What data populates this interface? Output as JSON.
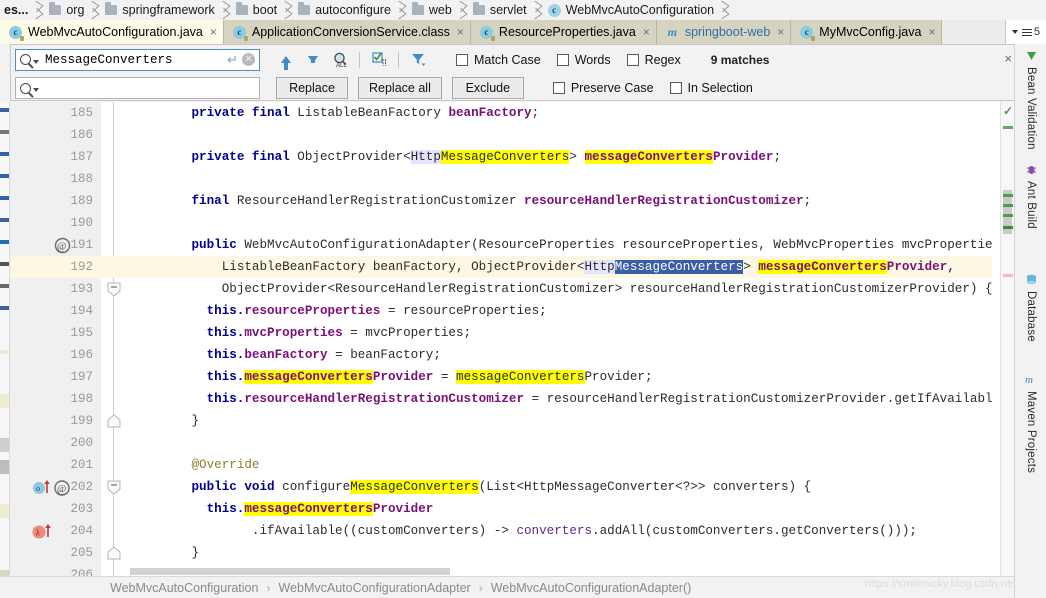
{
  "breadcrumb": {
    "items": [
      {
        "label": "es...",
        "icon": "folder-icon"
      },
      {
        "label": "org",
        "icon": "folder-icon"
      },
      {
        "label": "springframework",
        "icon": "folder-icon"
      },
      {
        "label": "boot",
        "icon": "folder-icon"
      },
      {
        "label": "autoconfigure",
        "icon": "folder-icon"
      },
      {
        "label": "web",
        "icon": "folder-icon"
      },
      {
        "label": "servlet",
        "icon": "folder-icon"
      },
      {
        "label": "WebMvcAutoConfiguration",
        "icon": "class-icon"
      }
    ]
  },
  "tabs": {
    "items": [
      {
        "label": "WebMvcAutoConfiguration.java",
        "icon": "class-icon",
        "active": true,
        "close": "×"
      },
      {
        "label": "ApplicationConversionService.class",
        "icon": "class-icon",
        "active": false,
        "close": "×"
      },
      {
        "label": "ResourceProperties.java",
        "icon": "class-icon",
        "active": false,
        "close": "×"
      },
      {
        "label": "springboot-web",
        "icon": "module-icon",
        "active": false,
        "close": "×"
      },
      {
        "label": "MyMvcConfig.java",
        "icon": "class-icon",
        "active": false,
        "close": "×"
      }
    ],
    "overflow_count": "5"
  },
  "find": {
    "search_value": "MessageConverters",
    "search_placeholder": "",
    "replace_value": "",
    "replace_placeholder": "",
    "buttons": {
      "replace": "Replace",
      "replace_all": "Replace all",
      "exclude": "Exclude"
    },
    "options": [
      {
        "label": "Match Case",
        "checked": false
      },
      {
        "label": "Words",
        "checked": false
      },
      {
        "label": "Regex",
        "checked": false
      },
      {
        "label": "Preserve Case",
        "checked": false
      },
      {
        "label": "In Selection",
        "checked": false
      }
    ],
    "matches_text": "9 matches",
    "close_label": "×",
    "tool_icons": [
      "find-previous-icon",
      "find-next-icon",
      "find-all-icon",
      "select-all-occurrences-icon",
      "filter-icon"
    ]
  },
  "editor": {
    "current_line": 192,
    "lines": [
      {
        "n": 185,
        "indent": 8,
        "tokens": [
          {
            "t": "private final ",
            "c": "kw"
          },
          {
            "t": "ListableBeanFactory ",
            "c": "plain"
          },
          {
            "t": "beanFactory",
            "c": "fld"
          },
          {
            "t": ";",
            "c": "plain"
          }
        ]
      },
      {
        "n": 186,
        "indent": 0,
        "tokens": []
      },
      {
        "n": 187,
        "indent": 8,
        "tokens": [
          {
            "t": "private final ",
            "c": "kw"
          },
          {
            "t": "ObjectProvider<",
            "c": "plain"
          },
          {
            "t": "Http",
            "c": "plain idhl"
          },
          {
            "t": "MessageConverters",
            "c": "plain hl"
          },
          {
            "t": "> ",
            "c": "plain"
          },
          {
            "t": "messageConverters",
            "c": "fld hl"
          },
          {
            "t": "Provider",
            "c": "fld"
          },
          {
            "t": ";",
            "c": "plain"
          }
        ]
      },
      {
        "n": 188,
        "indent": 0,
        "tokens": []
      },
      {
        "n": 189,
        "indent": 8,
        "tokens": [
          {
            "t": "final ",
            "c": "kw"
          },
          {
            "t": "ResourceHandlerRegistrationCustomizer ",
            "c": "plain"
          },
          {
            "t": "resourceHandlerRegistrationCustomizer",
            "c": "fld"
          },
          {
            "t": ";",
            "c": "plain"
          }
        ]
      },
      {
        "n": 190,
        "indent": 0,
        "tokens": []
      },
      {
        "n": 191,
        "indent": 8,
        "gutter": "annotation-icon",
        "tokens": [
          {
            "t": "public ",
            "c": "kw"
          },
          {
            "t": "WebMvcAutoConfigurationAdapter(ResourceProperties resourceProperties, WebMvcProperties mvcProperties,",
            "c": "plain"
          }
        ]
      },
      {
        "n": 192,
        "indent": 12,
        "current": true,
        "tokens": [
          {
            "t": "ListableBeanFactory beanFactory, ObjectProvider<",
            "c": "plain"
          },
          {
            "t": "Http",
            "c": "plain idhl"
          },
          {
            "t": "MessageConverters",
            "c": "sel"
          },
          {
            "t": "> ",
            "c": "plain"
          },
          {
            "t": "messageConverters",
            "c": "fld hl"
          },
          {
            "t": "Provider,",
            "c": "fld"
          }
        ]
      },
      {
        "n": 193,
        "indent": 12,
        "fold": "fold-end-icon",
        "tokens": [
          {
            "t": "ObjectProvider<ResourceHandlerRegistrationCustomizer> resourceHandlerRegistrationCustomizerProvider) {",
            "c": "plain"
          }
        ]
      },
      {
        "n": 194,
        "indent": 10,
        "tokens": [
          {
            "t": "this.",
            "c": "kw"
          },
          {
            "t": "resourceProperties",
            "c": "fld"
          },
          {
            "t": " = resourceProperties;",
            "c": "plain"
          }
        ]
      },
      {
        "n": 195,
        "indent": 10,
        "tokens": [
          {
            "t": "this.",
            "c": "kw"
          },
          {
            "t": "mvcProperties",
            "c": "fld"
          },
          {
            "t": " = mvcProperties;",
            "c": "plain"
          }
        ]
      },
      {
        "n": 196,
        "indent": 10,
        "tokens": [
          {
            "t": "this.",
            "c": "kw"
          },
          {
            "t": "beanFactory",
            "c": "fld"
          },
          {
            "t": " = beanFactory;",
            "c": "plain"
          }
        ]
      },
      {
        "n": 197,
        "indent": 10,
        "tokens": [
          {
            "t": "this.",
            "c": "kw"
          },
          {
            "t": "messageConverters",
            "c": "fld hl"
          },
          {
            "t": "Provider",
            "c": "fld"
          },
          {
            "t": " = ",
            "c": "plain"
          },
          {
            "t": "messageConverters",
            "c": "plain hl"
          },
          {
            "t": "Provider;",
            "c": "plain"
          }
        ]
      },
      {
        "n": 198,
        "indent": 10,
        "tokens": [
          {
            "t": "this.",
            "c": "kw"
          },
          {
            "t": "resourceHandlerRegistrationCustomizer",
            "c": "fld"
          },
          {
            "t": " = resourceHandlerRegistrationCustomizerProvider.getIfAvailable();",
            "c": "plain"
          }
        ]
      },
      {
        "n": 199,
        "indent": 8,
        "fold": "fold-collapse-icon",
        "tokens": [
          {
            "t": "}",
            "c": "plain"
          }
        ]
      },
      {
        "n": 200,
        "indent": 0,
        "tokens": []
      },
      {
        "n": 201,
        "indent": 8,
        "tokens": [
          {
            "t": "@Override",
            "c": "ann"
          }
        ]
      },
      {
        "n": 202,
        "indent": 8,
        "gutter": "override-method-icon",
        "fold": "fold-end-icon",
        "tokens": [
          {
            "t": "public void ",
            "c": "kw"
          },
          {
            "t": "configure",
            "c": "plain"
          },
          {
            "t": "MessageConverters",
            "c": "plain hl"
          },
          {
            "t": "(List<HttpMessageConverter<?>> converters) {",
            "c": "plain"
          }
        ]
      },
      {
        "n": 203,
        "indent": 10,
        "tokens": [
          {
            "t": "this.",
            "c": "kw"
          },
          {
            "t": "messageConverters",
            "c": "fld hl"
          },
          {
            "t": "Provider",
            "c": "fld"
          }
        ]
      },
      {
        "n": 204,
        "indent": 16,
        "gutter": "lambda-icon",
        "tokens": [
          {
            "t": ".ifAvailable((customConverters) -> ",
            "c": "plain"
          },
          {
            "t": "converters",
            "c": "par"
          },
          {
            "t": ".addAll(customConverters.getConverters()));",
            "c": "plain"
          }
        ]
      },
      {
        "n": 205,
        "indent": 8,
        "fold": "fold-collapse-icon",
        "tokens": [
          {
            "t": "}",
            "c": "plain"
          }
        ]
      },
      {
        "n": 206,
        "indent": 0,
        "tokens": []
      }
    ]
  },
  "right_tool_window": {
    "tabs": [
      {
        "label": "Bean Validation",
        "icon": "bean-validation-icon"
      },
      {
        "label": "Ant Build",
        "icon": "ant-build-icon"
      },
      {
        "label": "Database",
        "icon": "database-icon"
      },
      {
        "label": "Maven Projects",
        "icon": "maven-icon"
      }
    ]
  },
  "status_breadcrumb": {
    "items": [
      "WebMvcAutoConfiguration",
      "WebMvcAutoConfigurationAdapter",
      "WebMvcAutoConfigurationAdapter()"
    ],
    "separator": "›"
  },
  "watermark": "https://smilenicky.blog.csdn.net",
  "colors": {
    "highlight": "#ffff00",
    "selection": "#3a5fa8",
    "current_line": "#fdf8e3",
    "keyword": "#00008f",
    "field": "#7a0f7a",
    "annotation": "#8a7f2a",
    "accent": "#3f8cc8"
  }
}
